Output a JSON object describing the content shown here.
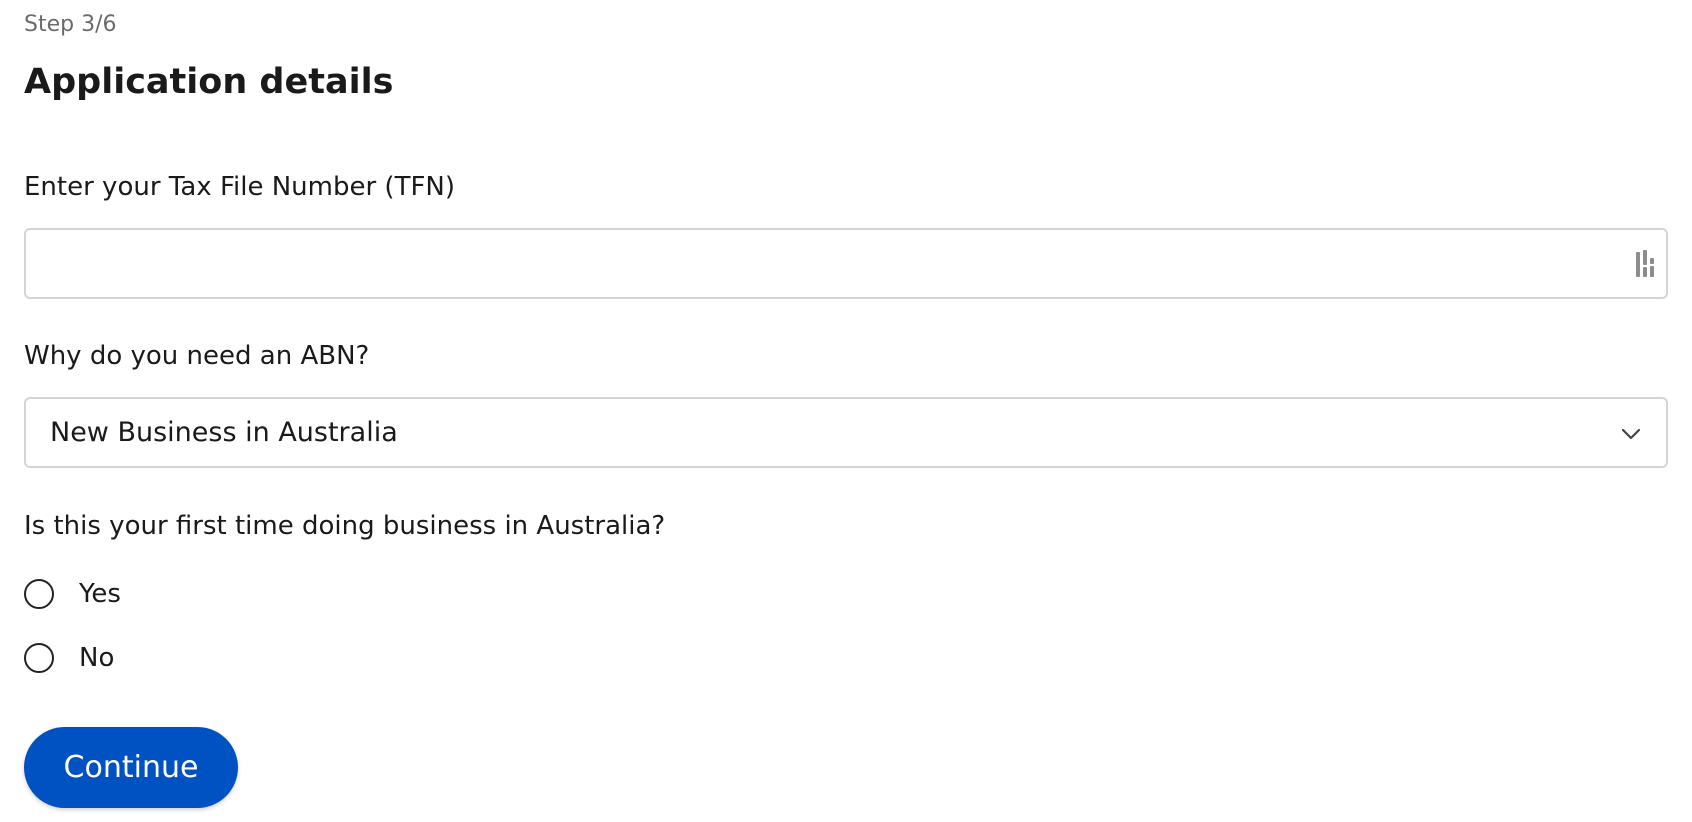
{
  "header": {
    "step": "Step 3/6",
    "title": "Application details"
  },
  "tfn": {
    "label": "Enter your Tax File Number (TFN)",
    "value": "",
    "placeholder": "",
    "icon": "password-manager-icon"
  },
  "abn_reason": {
    "label": "Why do you need an ABN?",
    "selected": "New Business in Australia",
    "icon": "chevron-down-icon"
  },
  "first_time": {
    "label": "Is this your first time doing business in Australia?",
    "options": [
      {
        "label": "Yes",
        "selected": false
      },
      {
        "label": "No",
        "selected": false
      }
    ]
  },
  "actions": {
    "continue_label": "Continue"
  },
  "colors": {
    "primary": "#0052c2",
    "border": "#d4d4d4",
    "text": "#1a1a1a",
    "muted_text": "#6b6b6b"
  }
}
